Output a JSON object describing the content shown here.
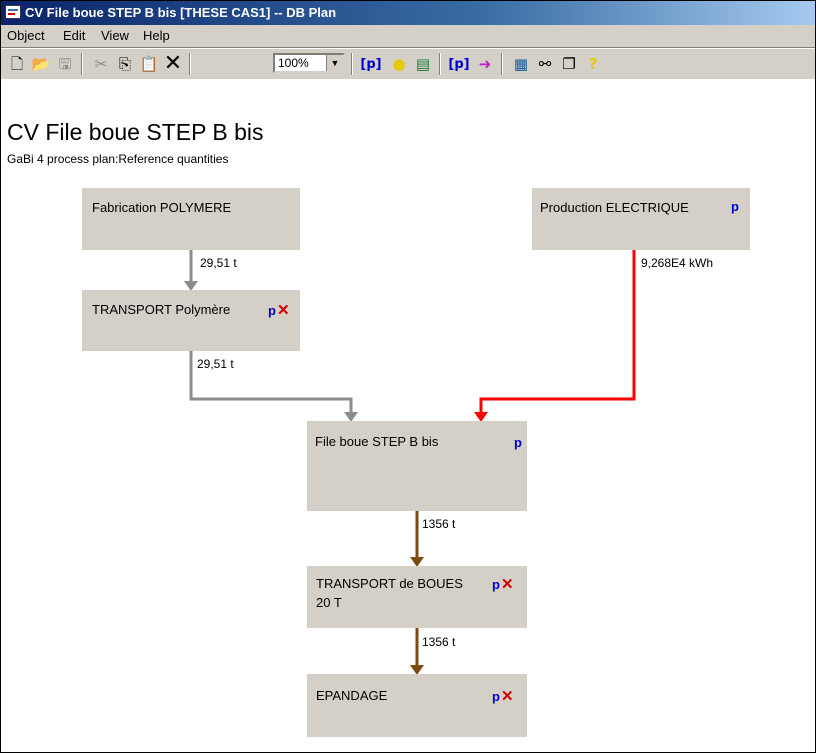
{
  "window": {
    "title": "CV File boue STEP B bis [THESE CAS1] -- DB Plan"
  },
  "menu": [
    "Object",
    "Edit",
    "View",
    "Help"
  ],
  "toolbar": {
    "zoom": "100%"
  },
  "plan": {
    "title": "CV File boue STEP B bis",
    "subtitle": "GaBi 4 process plan:Reference quantities"
  },
  "processes": {
    "polymere": {
      "name": "Fabrication POLYMERE",
      "badges": ""
    },
    "electrique": {
      "name": "Production ELECTRIQUE",
      "badges": "p"
    },
    "transport_polymere": {
      "name": "TRANSPORT Polymère",
      "badges": "pX"
    },
    "file_boue": {
      "name": "File boue STEP B bis",
      "badges": "p"
    },
    "transport_boues": {
      "name": "TRANSPORT de BOUES 20 T",
      "badges": "pX"
    },
    "epandage": {
      "name": "EPANDAGE",
      "badges": "pX"
    }
  },
  "flows": {
    "f1": "29,51 t",
    "f2": "29,51 t",
    "f3": "9,268E4 kWh",
    "f4": "1356 t",
    "f5": "1356 t"
  },
  "colors": {
    "gray_flow": "#8c8c8c",
    "red_flow": "#ff0000",
    "brown_flow": "#7a4a10"
  }
}
